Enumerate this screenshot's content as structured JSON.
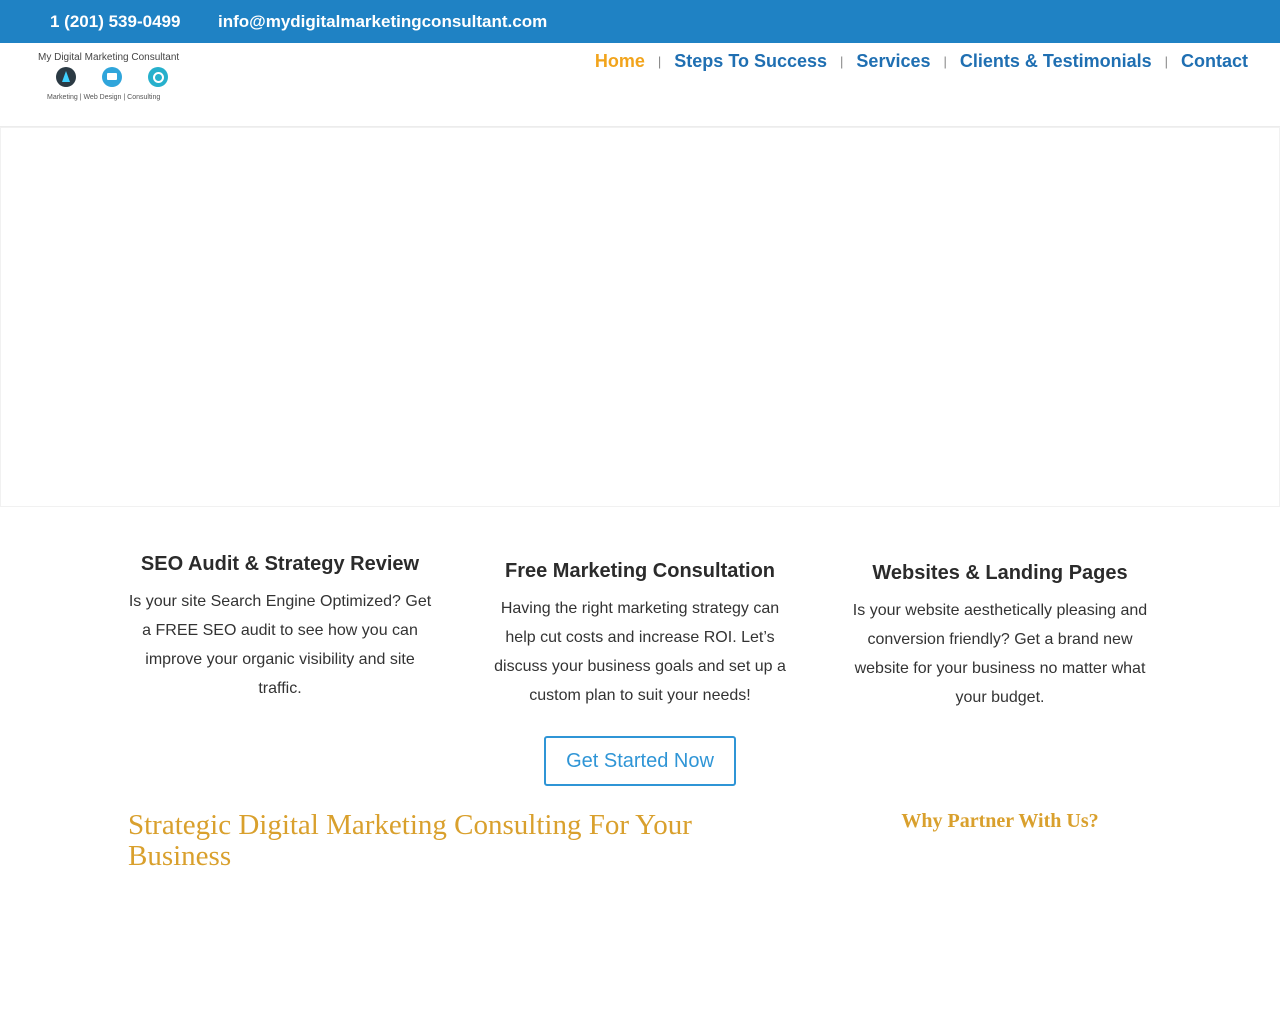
{
  "topbar": {
    "phone": "1 (201) 539-0499",
    "email": "info@mydigitalmarketingconsultant.com"
  },
  "logo": {
    "title": "My Digital Marketing Consultant",
    "subtitle": "Marketing | Web Design | Consulting"
  },
  "nav": {
    "items": [
      {
        "label": "Home",
        "active": true
      },
      {
        "label": "Steps To Success",
        "active": false
      },
      {
        "label": "Services",
        "active": false
      },
      {
        "label": "Clients & Testimonials",
        "active": false
      },
      {
        "label": "Contact",
        "active": false
      }
    ],
    "separator": "|"
  },
  "features": [
    {
      "title": "SEO Audit & Strategy Review",
      "text": "Is your site Search Engine Optimized? Get a FREE SEO audit to see how you can improve your organic visibility and site traffic."
    },
    {
      "title": "Free Marketing Consultation",
      "text": "Having the right marketing strategy can help cut costs and increase ROI. Let’s discuss your business goals and set up a custom plan to suit your needs!"
    },
    {
      "title": "Websites & Landing Pages",
      "text": "Is your website aesthetically pleasing and conversion friendly? Get a brand new website for your business no matter what your budget."
    }
  ],
  "cta": {
    "label": "Get Started Now"
  },
  "sections": {
    "strategic_heading": "Strategic Digital Marketing Consulting For Your Business",
    "why_heading": "Why Partner With Us?"
  },
  "colors": {
    "topbar_bg": "#1f82c4",
    "nav_link": "#1f6fb2",
    "nav_active": "#f2a41c",
    "cta_border": "#2f95d6",
    "heading_gold": "#d9a02d"
  }
}
